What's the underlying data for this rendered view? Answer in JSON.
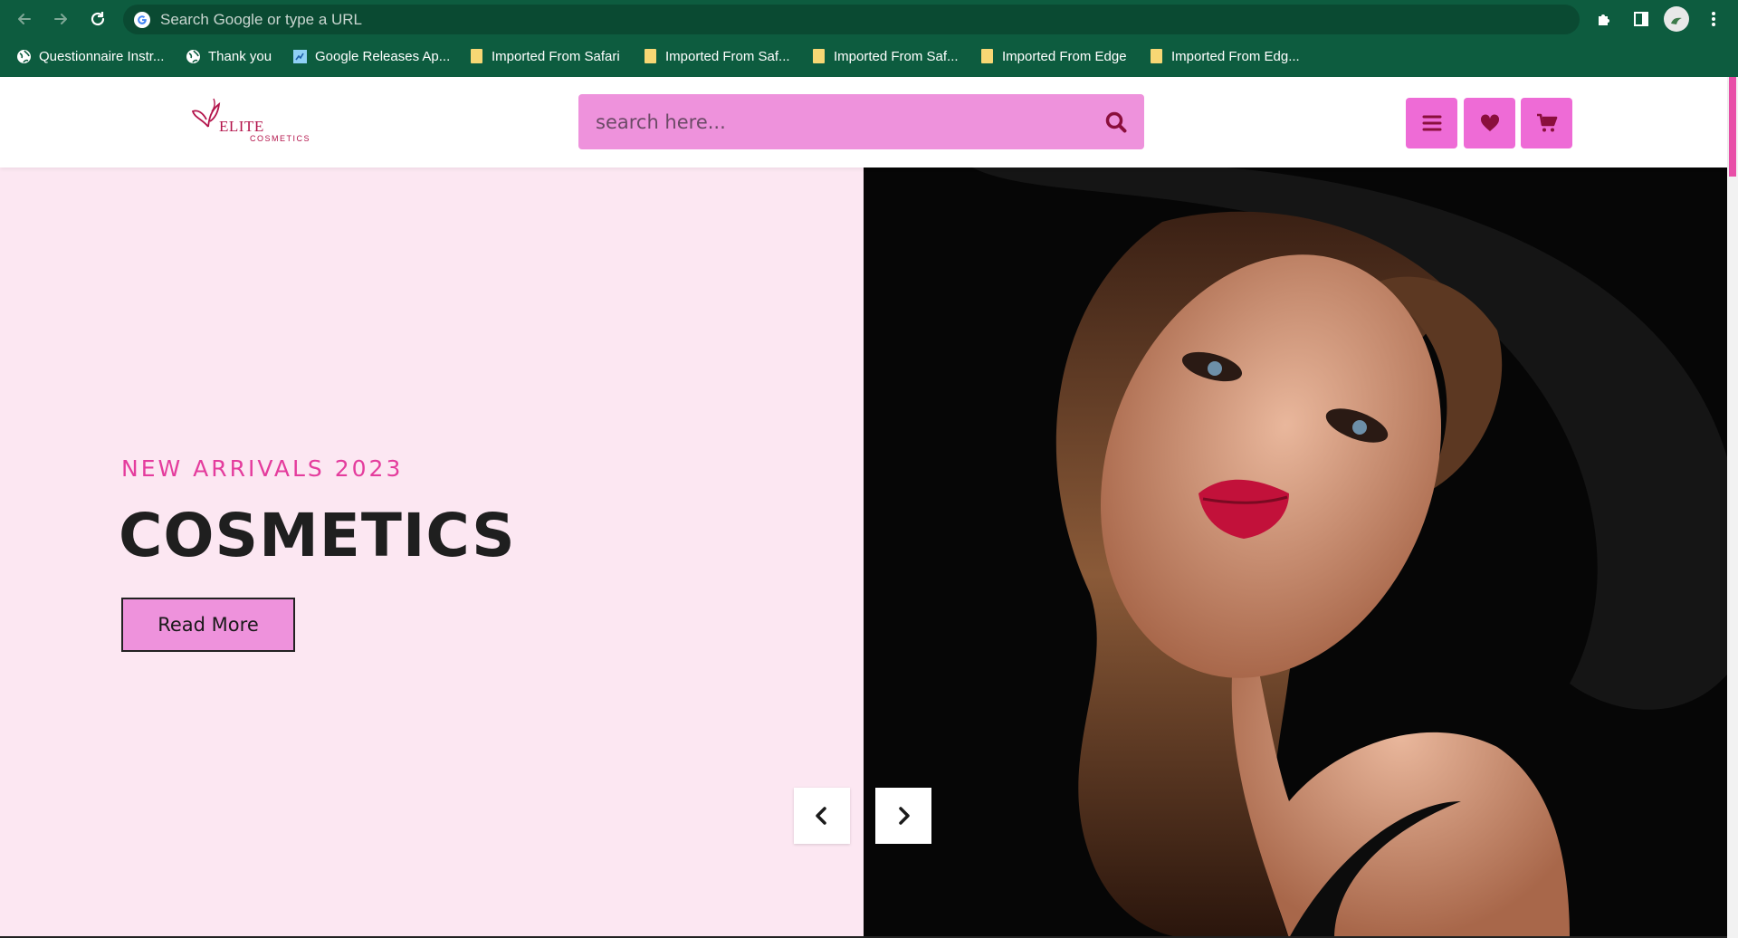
{
  "browser": {
    "omnibox_placeholder": "Search Google or type a URL",
    "icons": {
      "back": "arrow-left-icon",
      "forward": "arrow-right-icon",
      "reload": "reload-icon",
      "google": "google-g-icon",
      "extensions": "puzzle-icon",
      "side_panel": "side-panel-icon",
      "profile": "profile-avatar",
      "menu": "kebab-menu-icon"
    },
    "bookmarks": [
      {
        "label": "Questionnaire Instr...",
        "icon": "globe-icon"
      },
      {
        "label": "Thank you",
        "icon": "globe-icon"
      },
      {
        "label": "Google Releases Ap...",
        "icon": "page-icon"
      },
      {
        "label": "Imported From Safari",
        "icon": "folder-icon"
      },
      {
        "label": "Imported From Saf...",
        "icon": "folder-icon"
      },
      {
        "label": "Imported From Saf...",
        "icon": "folder-icon"
      },
      {
        "label": "Imported From Edge",
        "icon": "folder-icon"
      },
      {
        "label": "Imported From Edg...",
        "icon": "folder-icon"
      }
    ]
  },
  "site": {
    "logo": {
      "word1": "ELITE",
      "word2": "COSMETICS"
    },
    "search": {
      "placeholder": "search here..."
    },
    "header_buttons": [
      "menu-icon",
      "heart-icon",
      "cart-icon"
    ]
  },
  "hero": {
    "subtitle": "NEW ARRIVALS 2023",
    "title": "COSMETICS",
    "cta_label": "Read More",
    "colors": {
      "accent": "#e43c9d",
      "button_bg": "#ee92dc",
      "panel_bg": "#fce7f2",
      "header_btn": "#ee6bd6",
      "chrome_bg": "#0d5c3f"
    }
  }
}
